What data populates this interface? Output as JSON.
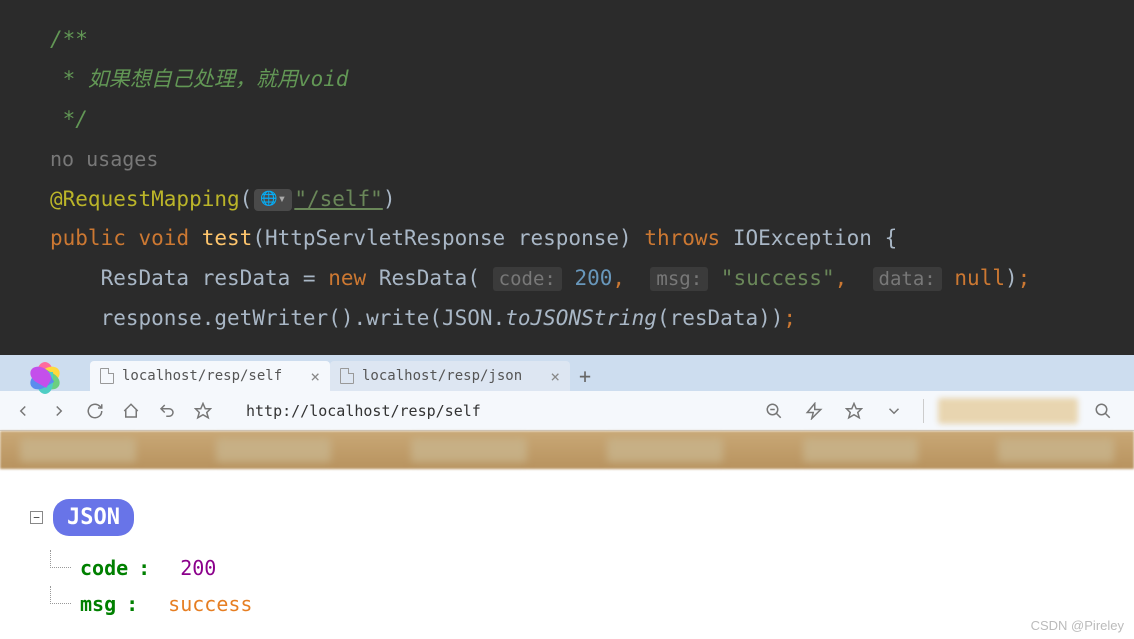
{
  "code": {
    "comment1": "/**",
    "comment2": " * 如果想自己处理，就用void",
    "comment3": " */",
    "hint_no_usages": "no usages",
    "annotation": "@RequestMapping",
    "mapping_path": "\"/self\"",
    "kw_public": "public",
    "kw_void": "void",
    "method_name": "test",
    "param_type": "HttpServletResponse",
    "param_name": "response",
    "kw_throws": "throws",
    "exception": "IOException",
    "type_resdata": "ResData",
    "var_resdata": "resData",
    "kw_new": "new",
    "hint_code": "code:",
    "val_code": "200",
    "hint_msg": "msg:",
    "val_msg": "\"success\"",
    "hint_data": "data:",
    "val_data": "null",
    "var_response": "response",
    "m_getwriter": "getWriter",
    "m_write": "write",
    "cls_json": "JSON",
    "m_tojson": "toJSONString",
    "arg_resdata": "resData"
  },
  "browser": {
    "tabs": [
      {
        "title": "localhost/resp/self",
        "active": true
      },
      {
        "title": "localhost/resp/json",
        "active": false
      }
    ],
    "url": "http://localhost/resp/self"
  },
  "json_view": {
    "badge": "JSON",
    "rows": [
      {
        "key": "code",
        "value": "200",
        "type": "num"
      },
      {
        "key": "msg",
        "value": "success",
        "type": "str"
      }
    ]
  },
  "watermark": "CSDN @Pireley"
}
